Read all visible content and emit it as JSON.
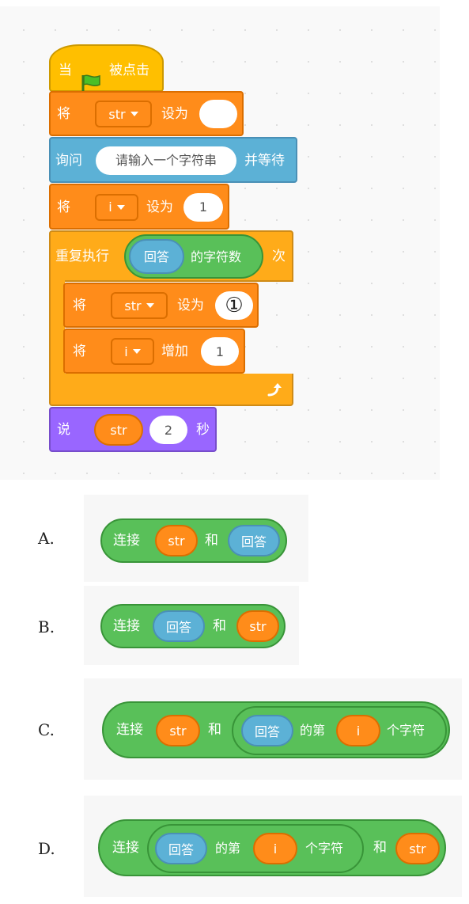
{
  "script": {
    "hat": {
      "prefix": "当",
      "suffix": "被点击",
      "icon": "green-flag-icon"
    },
    "set_str": {
      "verb": "将",
      "var": "str",
      "op": "设为",
      "value": ""
    },
    "ask": {
      "verb": "询问",
      "prompt": "请输入一个字符串",
      "suffix": "并等待"
    },
    "set_i": {
      "verb": "将",
      "var": "i",
      "op": "设为",
      "value": "1"
    },
    "repeat": {
      "verb": "重复执行",
      "answer": "回答",
      "length_of": "的字符数",
      "suffix": "次"
    },
    "inner_set": {
      "verb": "将",
      "var": "str",
      "op": "设为",
      "blank_marker": "①"
    },
    "inner_change": {
      "verb": "将",
      "var": "i",
      "op": "增加",
      "value": "1"
    },
    "say": {
      "verb": "说",
      "var": "str",
      "secs": "2",
      "unit": "秒"
    }
  },
  "options": [
    {
      "letter": "A.",
      "join": "连接",
      "a": "str",
      "and": "和",
      "b": "回答"
    },
    {
      "letter": "B.",
      "join": "连接",
      "a": "回答",
      "and": "和",
      "b": "str"
    },
    {
      "letter": "C.",
      "join": "连接",
      "a": "str",
      "and": "和",
      "b_answer": "回答",
      "b_of": "的第",
      "b_idx": "i",
      "b_char": "个字符"
    },
    {
      "letter": "D.",
      "join": "连接",
      "a_answer": "回答",
      "a_of": "的第",
      "a_idx": "i",
      "a_char": "个字符",
      "and": "和",
      "b": "str"
    }
  ],
  "colors": {
    "events": "#ffbf00",
    "variables": "#ff8c1a",
    "sensing": "#5cb1d6",
    "control": "#ffab19",
    "looks": "#9966ff",
    "operators": "#59c059"
  }
}
